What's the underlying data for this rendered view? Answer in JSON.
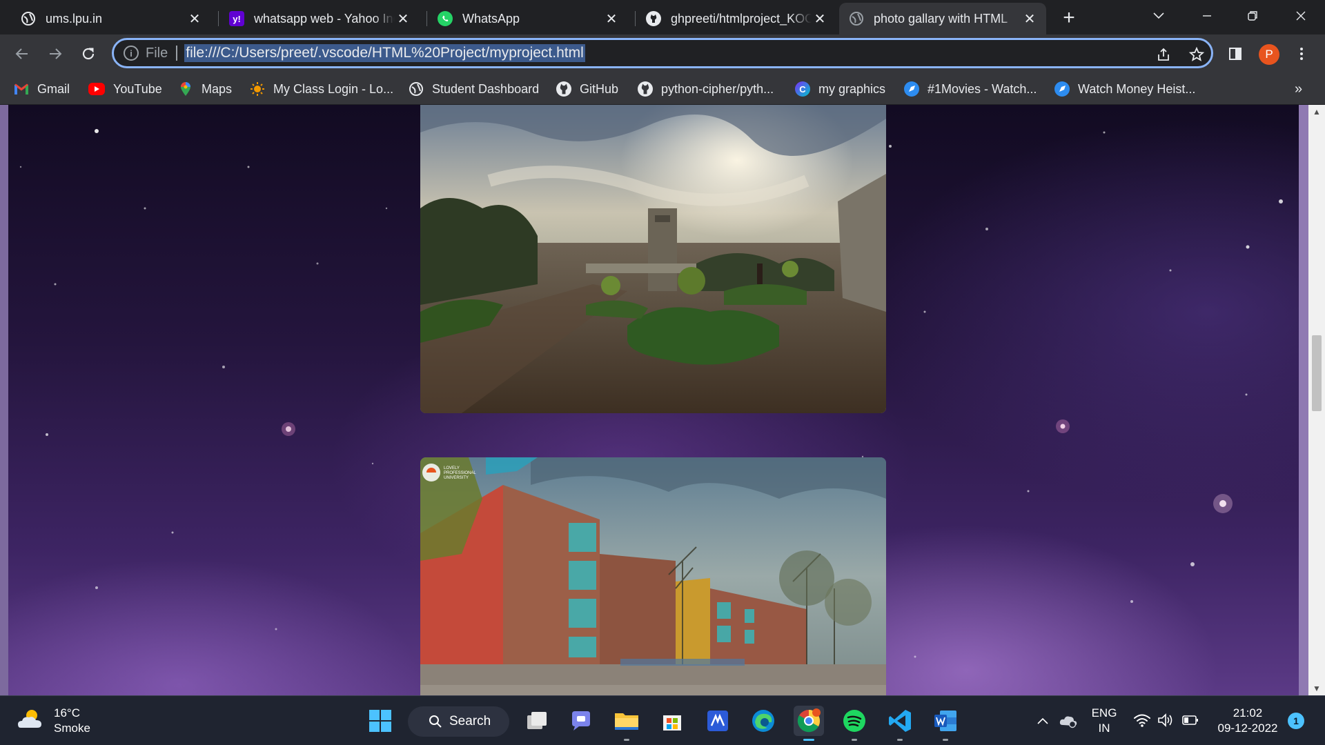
{
  "tabs": [
    {
      "title": "ums.lpu.in",
      "icon": "globe-icon"
    },
    {
      "title": "whatsapp web - Yahoo India Search",
      "icon": "yahoo-icon"
    },
    {
      "title": "WhatsApp",
      "icon": "whatsapp-icon"
    },
    {
      "title": "ghpreeti/htmlproject_KOO",
      "icon": "github-icon"
    },
    {
      "title": "photo gallary with HTML",
      "icon": "globe-icon",
      "active": true
    }
  ],
  "toolbar": {
    "scheme_chip": "File",
    "url": "file:///C:/Users/preet/.vscode/HTML%20Project/myproject.html",
    "profile_initial": "P"
  },
  "bookmarks": [
    {
      "label": "Gmail"
    },
    {
      "label": "YouTube"
    },
    {
      "label": "Maps"
    },
    {
      "label": "My Class Login - Lo..."
    },
    {
      "label": "Student Dashboard"
    },
    {
      "label": "GitHub"
    },
    {
      "label": "python-cipher/pyth..."
    },
    {
      "label": "my graphics"
    },
    {
      "label": "#1Movies - Watch..."
    },
    {
      "label": "Watch Money Heist..."
    }
  ],
  "page": {
    "photo2_watermark": [
      "LOVELY",
      "PROFESSIONAL",
      "UNIVERSITY"
    ]
  },
  "taskbar": {
    "weather_temp": "16°C",
    "weather_desc": "Smoke",
    "search_label": "Search",
    "lang_top": "ENG",
    "lang_bottom": "IN",
    "time": "21:02",
    "date": "09-12-2022",
    "notification_count": "1"
  },
  "colors": {
    "omnibox_focus": "#8ab4f8",
    "profile": "#e8541e",
    "tab_bg": "#202124",
    "toolbar_bg": "#35363a"
  }
}
